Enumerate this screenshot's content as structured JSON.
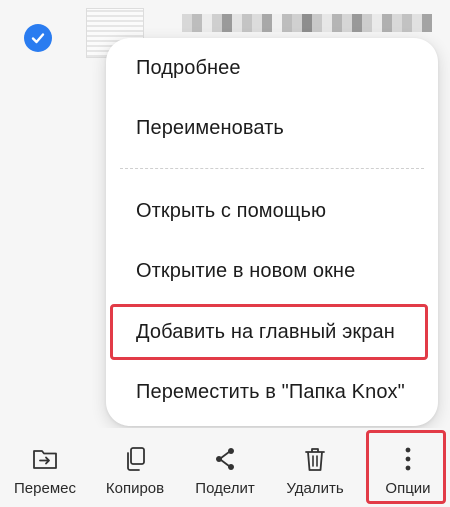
{
  "menu": {
    "items": [
      {
        "label": "Подробнее"
      },
      {
        "label": "Переименовать"
      },
      {
        "label": "Открыть с помощью"
      },
      {
        "label": "Открытие в новом окне"
      },
      {
        "label": "Добавить на главный экран"
      },
      {
        "label": "Переместить в \"Папка Knox\""
      }
    ]
  },
  "toolbar": {
    "items": [
      {
        "label": "Перемес",
        "icon": "move-folder-icon"
      },
      {
        "label": "Копиров",
        "icon": "copy-icon"
      },
      {
        "label": "Поделит",
        "icon": "share-icon"
      },
      {
        "label": "Удалить",
        "icon": "trash-icon"
      },
      {
        "label": "Опции",
        "icon": "more-vertical-icon"
      }
    ]
  },
  "colors": {
    "accent": "#2a7cf0",
    "highlight": "#e23b47"
  }
}
